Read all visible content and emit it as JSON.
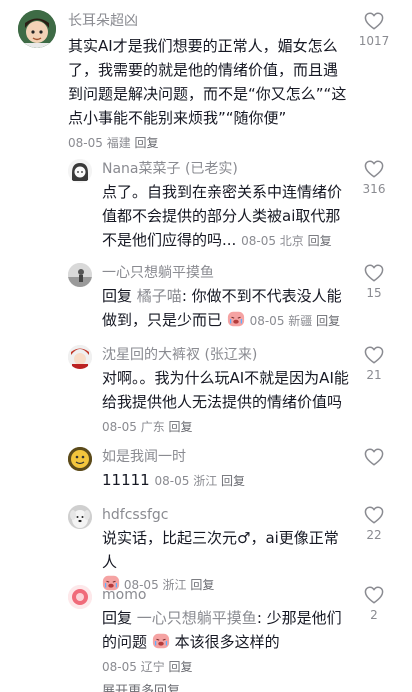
{
  "comments": [
    {
      "username": "长耳朵超凶",
      "text": "其实AI才是我们想要的正常人，媚女怎么了，我需要的就是他的情绪价值，而且遇到问题是解决问题，而不是“你又怎么”“这点小事能不能别来烦我”“随你便”",
      "date": "08-05",
      "location": "福建",
      "reply_label": "回复",
      "likes": "1017",
      "avatar_icon": "cartoon-boy-avatar"
    },
    {
      "username": "Nana菜菜子 (已老实)",
      "text": "点了。自我到在亲密关系中连情绪价值都不会提供的部分人类被ai取代那不是他们应得的吗...",
      "date": "08-05",
      "location": "北京",
      "reply_label": "回复",
      "likes": "316",
      "avatar_icon": "cartoon-girl-avatar"
    },
    {
      "username": "一心只想躺平摸鱼",
      "reply_prefix": "回复",
      "reply_to": "橘子喵",
      "text": ": 你做不到不代表没人能做到，只是少而已",
      "emoji": "crying-face-emoji",
      "date": "08-05",
      "location": "新疆",
      "reply_label": "回复",
      "likes": "15",
      "avatar_icon": "figure-photo-avatar"
    },
    {
      "username": "沈星回的大裤衩 (张辽来)",
      "text": "对啊。。我为什么玩AI不就是因为AI能给我提供他人无法提供的情绪价值吗",
      "date": "08-05",
      "location": "广东",
      "reply_label": "回复",
      "likes": "21",
      "avatar_icon": "anime-character-avatar"
    },
    {
      "username": "如是我闻一时",
      "text": "11111",
      "date": "08-05",
      "location": "浙江",
      "reply_label": "回复",
      "likes": "",
      "avatar_icon": "yellow-emoji-avatar"
    },
    {
      "username": "hdfcssfgc",
      "text": "说实话，比起三次元♂，ai更像正常人",
      "emoji": "crying-face-emoji",
      "date": "08-05",
      "location": "浙江",
      "reply_label": "回复",
      "likes": "22",
      "avatar_icon": "dog-photo-avatar"
    },
    {
      "username": "momo",
      "reply_prefix": "回复",
      "reply_to": "一心只想躺平摸鱼",
      "text": ": 少那是他们的问题",
      "text_after": "本该很多这样的",
      "emoji": "crying-face-emoji",
      "date": "08-05",
      "location": "辽宁",
      "reply_label": "回复",
      "likes": "2",
      "avatar_icon": "pink-blob-avatar"
    }
  ],
  "expand_label": "展开更多回复",
  "colors": {
    "text": "#161823",
    "meta": "#8a8b91",
    "heart_stroke": "#8a8b91"
  }
}
